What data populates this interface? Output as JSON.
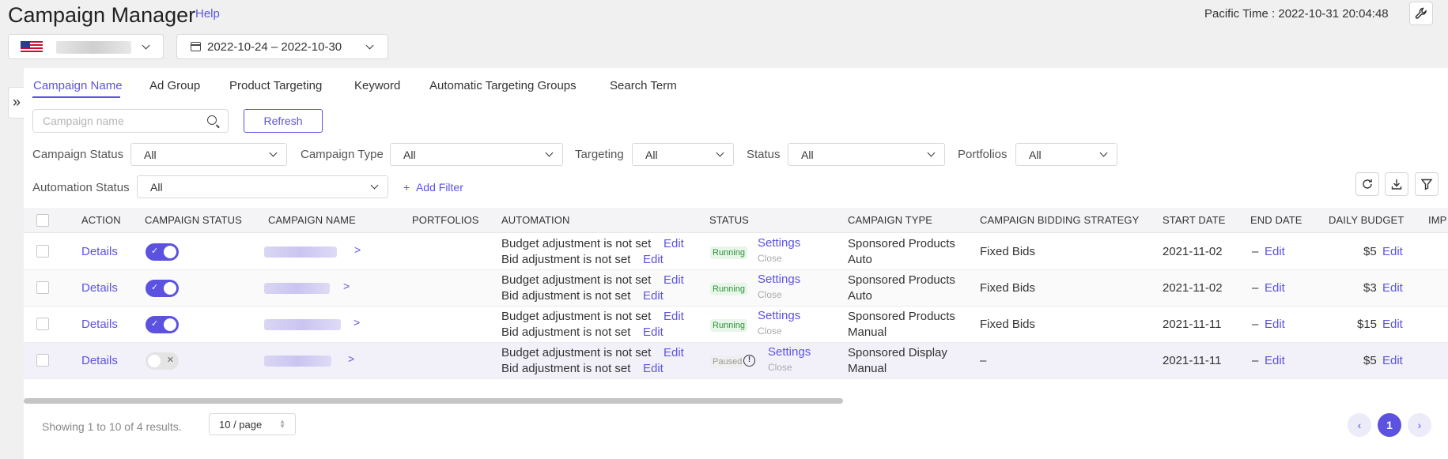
{
  "header": {
    "title": "Campaign Manager",
    "help": "Help",
    "pacific_time": "Pacific Time : 2022-10-31 20:04:48",
    "date_range": "2022-10-24 – 2022-10-30"
  },
  "tabs": [
    "Campaign Name",
    "Ad Group",
    "Product Targeting",
    "Keyword",
    "Automatic Targeting Groups",
    "Search Term"
  ],
  "search": {
    "placeholder": "Campaign name",
    "refresh": "Refresh"
  },
  "filters": {
    "campaign_status": {
      "label": "Campaign Status",
      "value": "All"
    },
    "campaign_type": {
      "label": "Campaign Type",
      "value": "All"
    },
    "targeting": {
      "label": "Targeting",
      "value": "All"
    },
    "status": {
      "label": "Status",
      "value": "All"
    },
    "portfolios": {
      "label": "Portfolios",
      "value": "All"
    },
    "automation_status": {
      "label": "Automation Status",
      "value": "All"
    },
    "add_filter": "Add Filter"
  },
  "table": {
    "headers": [
      "ACTION",
      "CAMPAIGN STATUS",
      "CAMPAIGN NAME",
      "PORTFOLIOS",
      "AUTOMATION",
      "STATUS",
      "CAMPAIGN TYPE",
      "CAMPAIGN BIDDING STRATEGY",
      "START DATE",
      "END DATE",
      "DAILY BUDGET",
      "IMP"
    ],
    "rows": [
      {
        "action": "Details",
        "enabled": true,
        "budget_adj": "Budget adjustment is not set",
        "bid_adj": "Bid adjustment is not set",
        "edit": "Edit",
        "status": "Running",
        "settings": "Settings",
        "close": "Close",
        "type_line1": "Sponsored Products",
        "type_line2": "Auto",
        "bidding": "Fixed Bids",
        "start": "2021-11-02",
        "end": "–",
        "budget": "$5"
      },
      {
        "action": "Details",
        "enabled": true,
        "budget_adj": "Budget adjustment is not set",
        "bid_adj": "Bid adjustment is not set",
        "edit": "Edit",
        "status": "Running",
        "settings": "Settings",
        "close": "Close",
        "type_line1": "Sponsored Products",
        "type_line2": "Auto",
        "bidding": "Fixed Bids",
        "start": "2021-11-02",
        "end": "–",
        "budget": "$3"
      },
      {
        "action": "Details",
        "enabled": true,
        "budget_adj": "Budget adjustment is not set",
        "bid_adj": "Bid adjustment is not set",
        "edit": "Edit",
        "status": "Running",
        "settings": "Settings",
        "close": "Close",
        "type_line1": "Sponsored Products",
        "type_line2": "Manual",
        "bidding": "Fixed Bids",
        "start": "2021-11-11",
        "end": "–",
        "budget": "$15"
      },
      {
        "action": "Details",
        "enabled": false,
        "budget_adj": "Budget adjustment is not set",
        "bid_adj": "Bid adjustment is not set",
        "edit": "Edit",
        "status": "Paused",
        "settings": "Settings",
        "close": "Close",
        "type_line1": "Sponsored Display",
        "type_line2": "Manual",
        "bidding": "–",
        "start": "2021-11-11",
        "end": "–",
        "budget": "$5"
      }
    ]
  },
  "pagination": {
    "showing": "Showing 1 to 10 of 4 results.",
    "per_page": "10 / page",
    "current": "1"
  },
  "colors": {
    "accent": "#5b53e0",
    "running": "#2f8f3a"
  }
}
